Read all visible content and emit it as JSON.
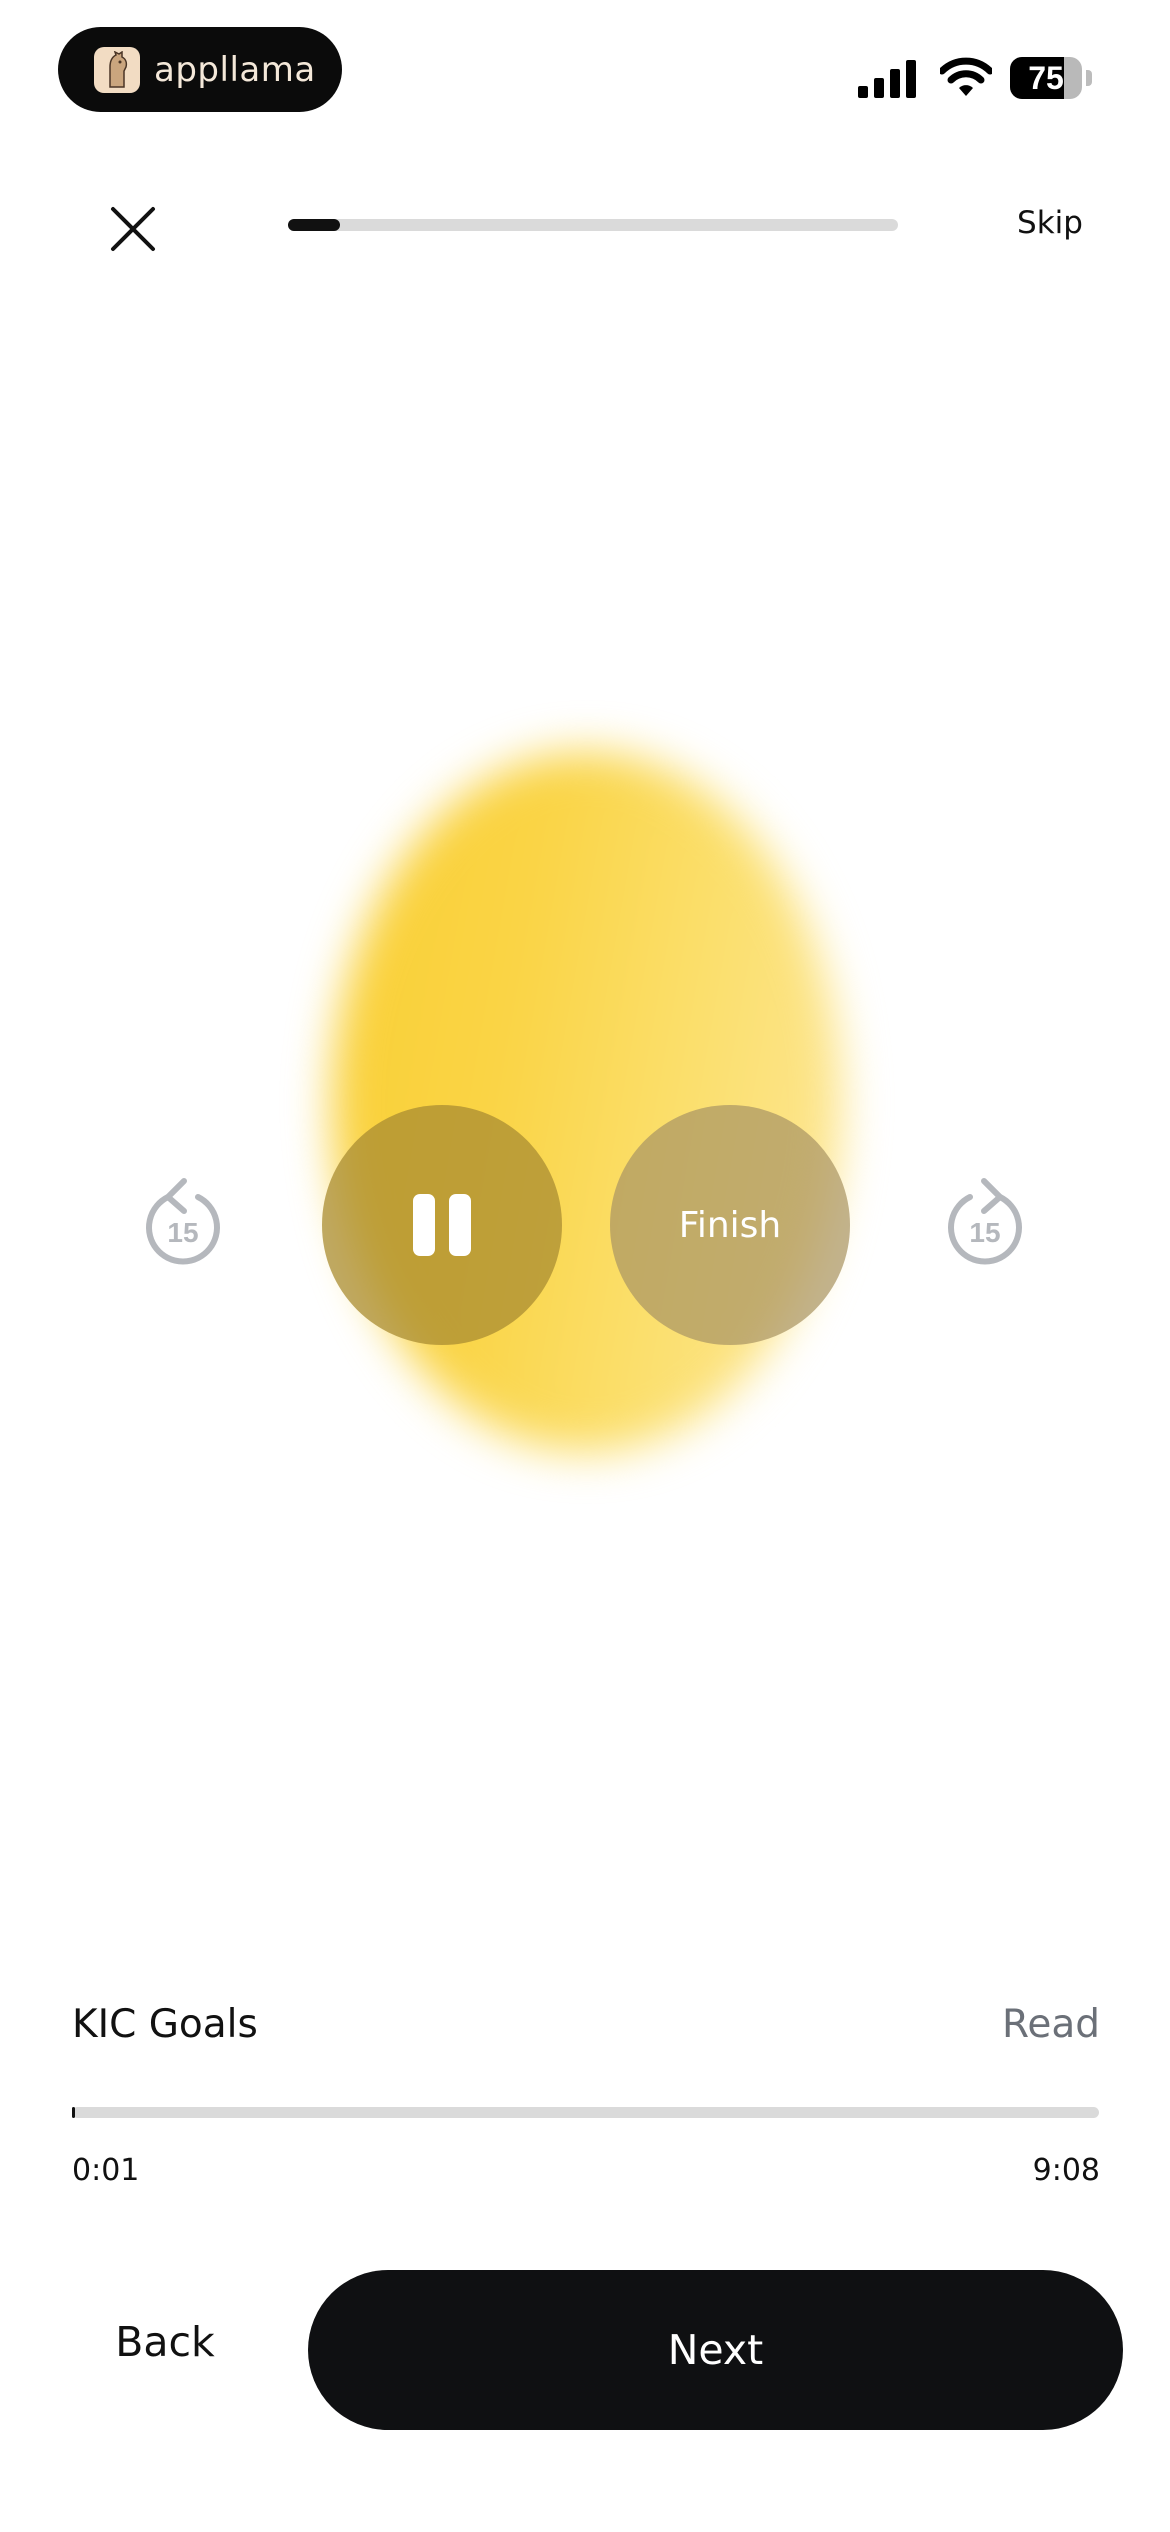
{
  "status_bar": {
    "brand": "appllama",
    "battery_level": "75",
    "battery_fraction": 0.75
  },
  "header": {
    "close_icon": "close-icon",
    "progress_fraction": 0.085,
    "skip_label": "Skip"
  },
  "player": {
    "rewind_seconds": "15",
    "forward_seconds": "15",
    "pause_icon": "pause-icon",
    "finish_label": "Finish",
    "accent_color": "#fad445"
  },
  "track": {
    "title": "KIC Goals",
    "read_label": "Read",
    "current_time": "0:01",
    "total_time": "9:08",
    "progress_fraction": 0.002
  },
  "footer": {
    "back_label": "Back",
    "next_label": "Next"
  }
}
